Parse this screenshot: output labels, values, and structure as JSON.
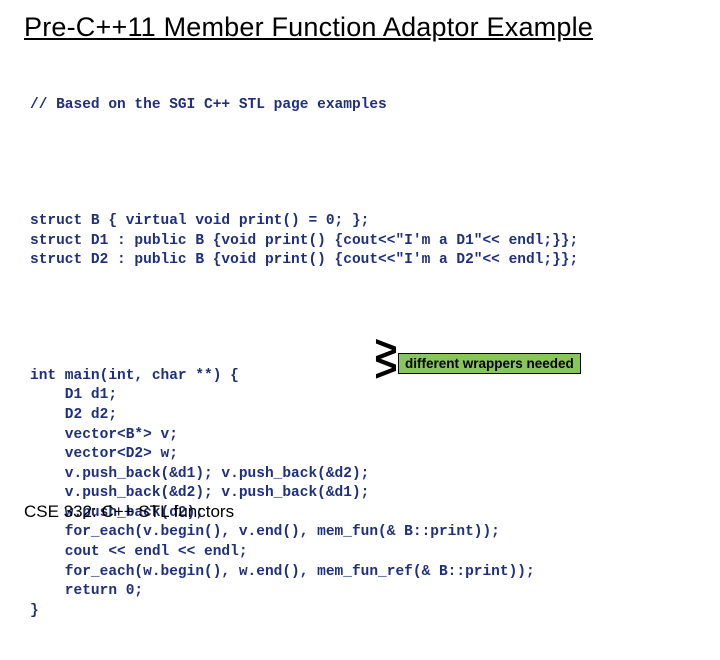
{
  "title": "Pre-C++11 Member Function Adaptor Example",
  "code": {
    "comment": "// Based on the SGI C++ STL page examples",
    "structs": "struct B { virtual void print() = 0; };\nstruct D1 : public B {void print() {cout<<\"I'm a D1\"<< endl;}};\nstruct D2 : public B {void print() {cout<<\"I'm a D2\"<< endl;}};",
    "main": "int main(int, char **) {\n    D1 d1;\n    D2 d2;\n    vector<B*> v;\n    vector<D2> w;\n    v.push_back(&d1); v.push_back(&d2);\n    v.push_back(&d2); v.push_back(&d1);\n    w.push_back(d2);\n    for_each(v.begin(), v.end(), mem_fun(& B::print));\n    cout << endl << endl;\n    for_each(w.begin(), w.end(), mem_fun_ref(& B::print));\n    return 0;\n}"
  },
  "callout": {
    "text": "different wrappers needed"
  },
  "footer": "CSE 332: C++ STL functors"
}
